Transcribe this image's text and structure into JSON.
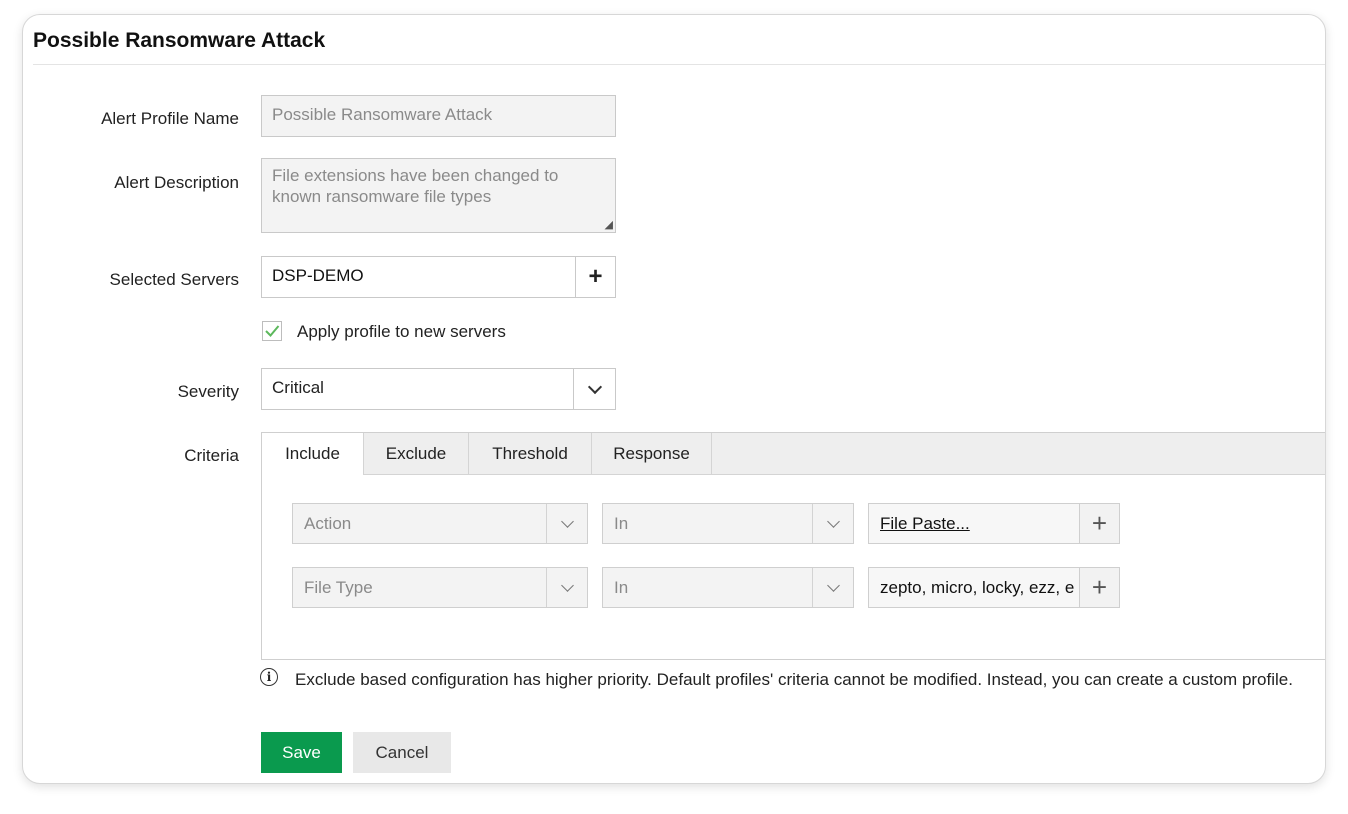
{
  "dialog": {
    "title": "Possible Ransomware Attack"
  },
  "form": {
    "profile_name_label": "Alert Profile Name",
    "profile_name_value": "Possible Ransomware Attack",
    "description_label": "Alert Description",
    "description_value": "File extensions have been changed to known ransomware file types",
    "servers_label": "Selected Servers",
    "servers_value": "DSP-DEMO",
    "add_symbol": "+",
    "apply_new_servers_label": "Apply profile to new servers",
    "apply_new_servers_checked": true,
    "severity_label": "Severity",
    "severity_value": "Critical",
    "criteria_label": "Criteria"
  },
  "criteria": {
    "tabs": [
      {
        "label": "Include",
        "active": true
      },
      {
        "label": "Exclude",
        "active": false
      },
      {
        "label": "Threshold",
        "active": false
      },
      {
        "label": "Response",
        "active": false
      }
    ],
    "rows": [
      {
        "field": "Action",
        "operator": "In",
        "value": "File Paste..."
      },
      {
        "field": "File Type",
        "operator": "In",
        "value": "zepto, micro, locky, ezz, ecc"
      }
    ]
  },
  "info": {
    "icon": "info-icon",
    "text": "Exclude based configuration has higher priority. Default profiles' criteria cannot be modified. Instead, you can create a custom profile."
  },
  "buttons": {
    "save": "Save",
    "cancel": "Cancel"
  },
  "colors": {
    "save": "#0a9a4e",
    "check": "#5cb85c"
  }
}
